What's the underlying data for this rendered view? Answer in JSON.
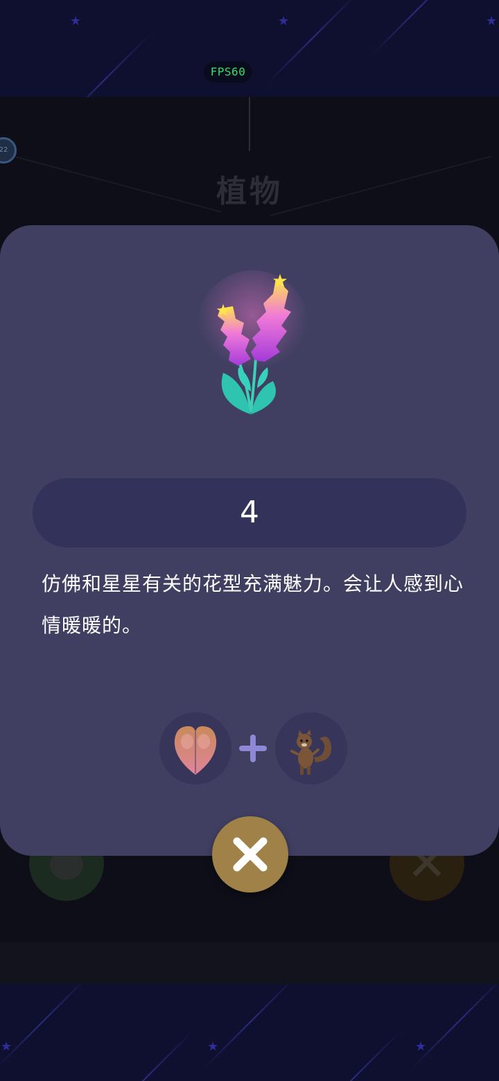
{
  "status": {
    "fps_label": "FPS60"
  },
  "background": {
    "category_title": "植物",
    "level_badge": "22"
  },
  "item_modal": {
    "count": "4",
    "description": "仿佛和星星有关的花型充满魅力。会让人感到心情暖暖的。",
    "recipe": {
      "ingredient_1_icon": "heart-seed-icon",
      "operator_icon": "plus-icon",
      "ingredient_2_icon": "squirrel-icon"
    },
    "close_icon": "close-icon"
  },
  "colors": {
    "modal_bg": "#403f62",
    "count_pill_bg": "#32325a",
    "close_button_bg": "#a08148",
    "fps_text": "#2ee06a"
  }
}
